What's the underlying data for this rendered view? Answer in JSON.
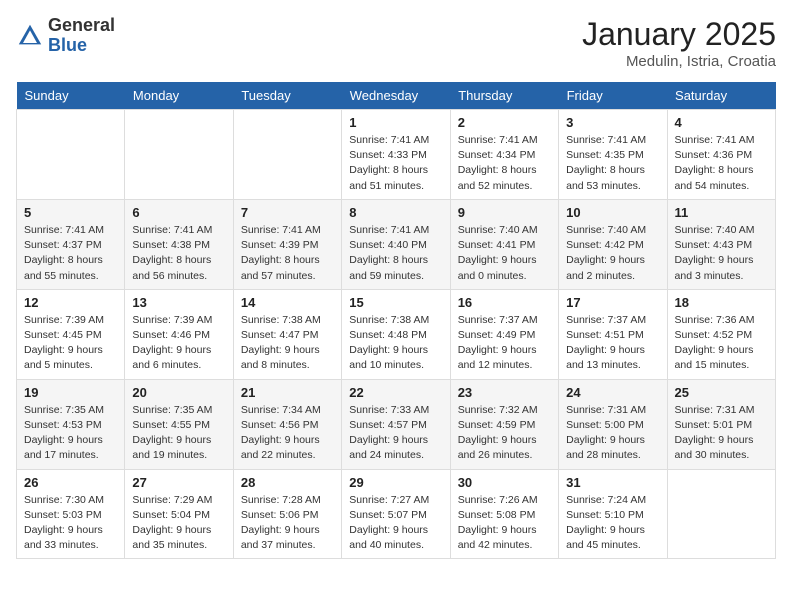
{
  "header": {
    "logo_general": "General",
    "logo_blue": "Blue",
    "month_title": "January 2025",
    "location": "Medulin, Istria, Croatia"
  },
  "weekdays": [
    "Sunday",
    "Monday",
    "Tuesday",
    "Wednesday",
    "Thursday",
    "Friday",
    "Saturday"
  ],
  "weeks": [
    [
      {
        "day": "",
        "sunrise": "",
        "sunset": "",
        "daylight": ""
      },
      {
        "day": "",
        "sunrise": "",
        "sunset": "",
        "daylight": ""
      },
      {
        "day": "",
        "sunrise": "",
        "sunset": "",
        "daylight": ""
      },
      {
        "day": "1",
        "sunrise": "Sunrise: 7:41 AM",
        "sunset": "Sunset: 4:33 PM",
        "daylight": "Daylight: 8 hours and 51 minutes."
      },
      {
        "day": "2",
        "sunrise": "Sunrise: 7:41 AM",
        "sunset": "Sunset: 4:34 PM",
        "daylight": "Daylight: 8 hours and 52 minutes."
      },
      {
        "day": "3",
        "sunrise": "Sunrise: 7:41 AM",
        "sunset": "Sunset: 4:35 PM",
        "daylight": "Daylight: 8 hours and 53 minutes."
      },
      {
        "day": "4",
        "sunrise": "Sunrise: 7:41 AM",
        "sunset": "Sunset: 4:36 PM",
        "daylight": "Daylight: 8 hours and 54 minutes."
      }
    ],
    [
      {
        "day": "5",
        "sunrise": "Sunrise: 7:41 AM",
        "sunset": "Sunset: 4:37 PM",
        "daylight": "Daylight: 8 hours and 55 minutes."
      },
      {
        "day": "6",
        "sunrise": "Sunrise: 7:41 AM",
        "sunset": "Sunset: 4:38 PM",
        "daylight": "Daylight: 8 hours and 56 minutes."
      },
      {
        "day": "7",
        "sunrise": "Sunrise: 7:41 AM",
        "sunset": "Sunset: 4:39 PM",
        "daylight": "Daylight: 8 hours and 57 minutes."
      },
      {
        "day": "8",
        "sunrise": "Sunrise: 7:41 AM",
        "sunset": "Sunset: 4:40 PM",
        "daylight": "Daylight: 8 hours and 59 minutes."
      },
      {
        "day": "9",
        "sunrise": "Sunrise: 7:40 AM",
        "sunset": "Sunset: 4:41 PM",
        "daylight": "Daylight: 9 hours and 0 minutes."
      },
      {
        "day": "10",
        "sunrise": "Sunrise: 7:40 AM",
        "sunset": "Sunset: 4:42 PM",
        "daylight": "Daylight: 9 hours and 2 minutes."
      },
      {
        "day": "11",
        "sunrise": "Sunrise: 7:40 AM",
        "sunset": "Sunset: 4:43 PM",
        "daylight": "Daylight: 9 hours and 3 minutes."
      }
    ],
    [
      {
        "day": "12",
        "sunrise": "Sunrise: 7:39 AM",
        "sunset": "Sunset: 4:45 PM",
        "daylight": "Daylight: 9 hours and 5 minutes."
      },
      {
        "day": "13",
        "sunrise": "Sunrise: 7:39 AM",
        "sunset": "Sunset: 4:46 PM",
        "daylight": "Daylight: 9 hours and 6 minutes."
      },
      {
        "day": "14",
        "sunrise": "Sunrise: 7:38 AM",
        "sunset": "Sunset: 4:47 PM",
        "daylight": "Daylight: 9 hours and 8 minutes."
      },
      {
        "day": "15",
        "sunrise": "Sunrise: 7:38 AM",
        "sunset": "Sunset: 4:48 PM",
        "daylight": "Daylight: 9 hours and 10 minutes."
      },
      {
        "day": "16",
        "sunrise": "Sunrise: 7:37 AM",
        "sunset": "Sunset: 4:49 PM",
        "daylight": "Daylight: 9 hours and 12 minutes."
      },
      {
        "day": "17",
        "sunrise": "Sunrise: 7:37 AM",
        "sunset": "Sunset: 4:51 PM",
        "daylight": "Daylight: 9 hours and 13 minutes."
      },
      {
        "day": "18",
        "sunrise": "Sunrise: 7:36 AM",
        "sunset": "Sunset: 4:52 PM",
        "daylight": "Daylight: 9 hours and 15 minutes."
      }
    ],
    [
      {
        "day": "19",
        "sunrise": "Sunrise: 7:35 AM",
        "sunset": "Sunset: 4:53 PM",
        "daylight": "Daylight: 9 hours and 17 minutes."
      },
      {
        "day": "20",
        "sunrise": "Sunrise: 7:35 AM",
        "sunset": "Sunset: 4:55 PM",
        "daylight": "Daylight: 9 hours and 19 minutes."
      },
      {
        "day": "21",
        "sunrise": "Sunrise: 7:34 AM",
        "sunset": "Sunset: 4:56 PM",
        "daylight": "Daylight: 9 hours and 22 minutes."
      },
      {
        "day": "22",
        "sunrise": "Sunrise: 7:33 AM",
        "sunset": "Sunset: 4:57 PM",
        "daylight": "Daylight: 9 hours and 24 minutes."
      },
      {
        "day": "23",
        "sunrise": "Sunrise: 7:32 AM",
        "sunset": "Sunset: 4:59 PM",
        "daylight": "Daylight: 9 hours and 26 minutes."
      },
      {
        "day": "24",
        "sunrise": "Sunrise: 7:31 AM",
        "sunset": "Sunset: 5:00 PM",
        "daylight": "Daylight: 9 hours and 28 minutes."
      },
      {
        "day": "25",
        "sunrise": "Sunrise: 7:31 AM",
        "sunset": "Sunset: 5:01 PM",
        "daylight": "Daylight: 9 hours and 30 minutes."
      }
    ],
    [
      {
        "day": "26",
        "sunrise": "Sunrise: 7:30 AM",
        "sunset": "Sunset: 5:03 PM",
        "daylight": "Daylight: 9 hours and 33 minutes."
      },
      {
        "day": "27",
        "sunrise": "Sunrise: 7:29 AM",
        "sunset": "Sunset: 5:04 PM",
        "daylight": "Daylight: 9 hours and 35 minutes."
      },
      {
        "day": "28",
        "sunrise": "Sunrise: 7:28 AM",
        "sunset": "Sunset: 5:06 PM",
        "daylight": "Daylight: 9 hours and 37 minutes."
      },
      {
        "day": "29",
        "sunrise": "Sunrise: 7:27 AM",
        "sunset": "Sunset: 5:07 PM",
        "daylight": "Daylight: 9 hours and 40 minutes."
      },
      {
        "day": "30",
        "sunrise": "Sunrise: 7:26 AM",
        "sunset": "Sunset: 5:08 PM",
        "daylight": "Daylight: 9 hours and 42 minutes."
      },
      {
        "day": "31",
        "sunrise": "Sunrise: 7:24 AM",
        "sunset": "Sunset: 5:10 PM",
        "daylight": "Daylight: 9 hours and 45 minutes."
      },
      {
        "day": "",
        "sunrise": "",
        "sunset": "",
        "daylight": ""
      }
    ]
  ]
}
